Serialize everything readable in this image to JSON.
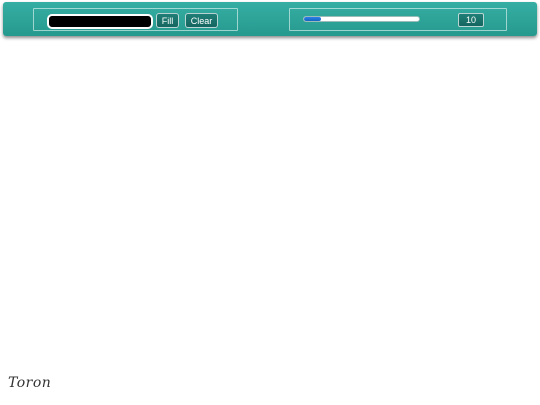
{
  "toolbar": {
    "color": {
      "value": "#000000"
    },
    "fill_label": "Fill",
    "clear_label": "Clear",
    "brush": {
      "size_fraction": 0.15,
      "value_label": "10"
    }
  },
  "footer": {
    "signature": "Toron"
  },
  "colors": {
    "toolbar_bg": "#2aa396",
    "slider_fill": "#1e78d8"
  }
}
